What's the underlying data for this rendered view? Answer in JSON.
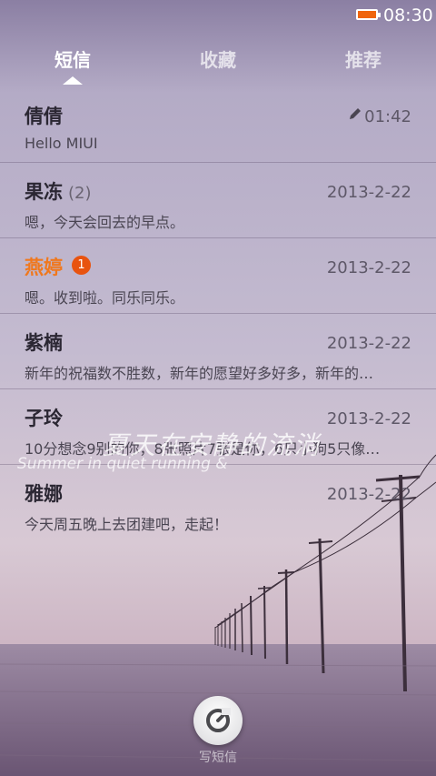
{
  "status_bar": {
    "time": "08:30",
    "battery_icon": "battery-icon",
    "battery_color": "#f0650e"
  },
  "tabs": [
    {
      "label": "短信",
      "active": true
    },
    {
      "label": "收藏",
      "active": false
    },
    {
      "label": "推荐",
      "active": false
    }
  ],
  "conversations": [
    {
      "name": "倩倩",
      "count": "",
      "badge": "",
      "date": "01:42",
      "draft": true,
      "preview": "Hello MIUI"
    },
    {
      "name": "果冻",
      "count": "(2)",
      "badge": "",
      "date": "2013-2-22",
      "draft": false,
      "preview": "嗯，今天会回去的早点。"
    },
    {
      "name": "燕婷",
      "count": "",
      "badge": "1",
      "date": "2013-2-22",
      "draft": false,
      "preview": "嗯。收到啦。同乐同乐。"
    },
    {
      "name": "紫楠",
      "count": "",
      "badge": "",
      "date": "2013-2-22",
      "draft": false,
      "preview": "新年的祝福数不胜数，新年的愿望好多好多，新年的…"
    },
    {
      "name": "子玲",
      "count": "",
      "badge": "",
      "date": "2013-2-22",
      "draft": false,
      "preview": "10分想念9别的你，8张照片7张是你，6只小狗5只像…"
    },
    {
      "name": "雅娜",
      "count": "",
      "badge": "",
      "date": "2013-2-22",
      "draft": false,
      "preview": "今天周五晚上去团建吧，走起！"
    }
  ],
  "wallpaper_text": {
    "line1": "夏天在安静的流淌",
    "line2": "Summer in quiet running &"
  },
  "compose": {
    "label": "写短信",
    "icon": "compose-icon"
  },
  "colors": {
    "unread_name": "#f0781d",
    "badge": "#e8530f"
  }
}
